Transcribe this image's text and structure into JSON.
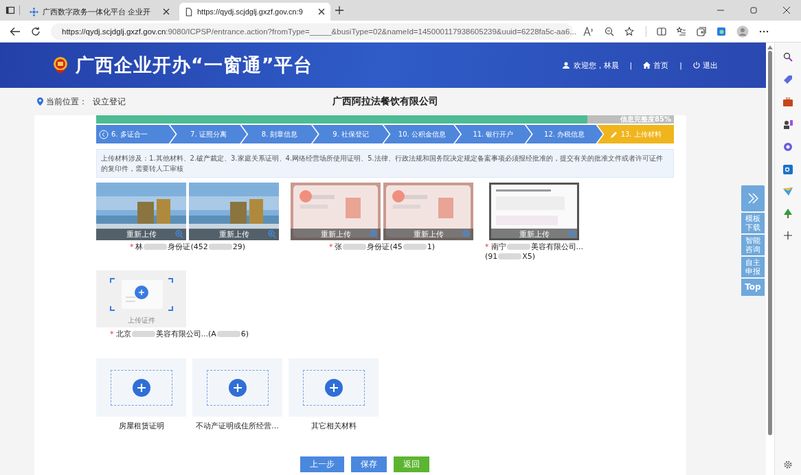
{
  "browser": {
    "tabs": [
      {
        "title": "广西数字政务一体化平台 企业开",
        "selected": false
      },
      {
        "title": "https://qydj.scjdglj.gxzf.gov.cn:9",
        "selected": true
      }
    ],
    "url_host": "https://qydj.scjdglj.gxzf.gov.cn",
    "url_rest": ":9080/ICPSP/entrance.action?fromType=_____&busiType=02&nameId=145000117938605239&uuid=6228fa5c-aa6..."
  },
  "header": {
    "title": "广西企业开办“一窗通”平台",
    "welcome": "欢迎您，林晨",
    "separators": [
      "|",
      "|"
    ],
    "home": "首页",
    "logout": "退出"
  },
  "breadcrumb": {
    "label": "当前位置：",
    "value": "设立登记"
  },
  "company": "广西阿拉法餐饮有限公司",
  "progress": {
    "level": 0.85,
    "label": "信息完整度85%"
  },
  "steps": [
    {
      "label": "6. 多证合一",
      "selected": false
    },
    {
      "label": "7. 证照分离",
      "selected": false
    },
    {
      "label": "8. 刻章信息",
      "selected": false
    },
    {
      "label": "9. 社保登记",
      "selected": false
    },
    {
      "label": "10. 公积金信息",
      "selected": false
    },
    {
      "label": "11. 银行开户",
      "selected": false
    },
    {
      "label": "12. 办税信息",
      "selected": false
    },
    {
      "label": "13. 上传材料",
      "selected": true
    }
  ],
  "notice": "上传材料涉及：1.其他材料、2.破产裁定、3.家庭关系证明、4.网络经营场所使用证明、5.法律、行政法规和国务院决定规定备案事项必须报经批准的，提交有关的批准文件或者许可证件的复印件，需要转人工审核",
  "documents": [
    {
      "mark": "*",
      "images": [
        {
          "kind": "landscape",
          "action": "重新上传"
        },
        {
          "kind": "landscape",
          "action": "重新上传"
        }
      ],
      "lines": [
        [
          "林",
          "身份证(452",
          "29)"
        ]
      ]
    },
    {
      "mark": "*",
      "images": [
        {
          "kind": "card",
          "action": "重新上传"
        },
        {
          "kind": "card",
          "action": "重新上传"
        }
      ],
      "lines": [
        [
          "张",
          "身份证(45",
          "1)"
        ]
      ]
    },
    {
      "mark": "*",
      "images": [
        {
          "kind": "document",
          "action": "重新上传"
        }
      ],
      "lines": [
        [
          "南宁",
          "美容有限公司..."
        ],
        [
          "(91",
          "X5)"
        ]
      ]
    }
  ],
  "upload": {
    "label": "上传证件",
    "mark": "*",
    "lines": [
      [
        "北京",
        "美容有限公司...(A",
        "6)"
      ]
    ]
  },
  "add_cards": [
    "房屋租赁证明",
    "不动产证明或住所经营...",
    "其它相关材料"
  ],
  "buttons": [
    {
      "label": "上一步",
      "kind": "primary"
    },
    {
      "label": "保存",
      "kind": "primary"
    },
    {
      "label": "返回",
      "kind": "success"
    }
  ],
  "float_panel": [
    "模板下载",
    "智能咨询",
    "自主申报",
    "Top"
  ]
}
